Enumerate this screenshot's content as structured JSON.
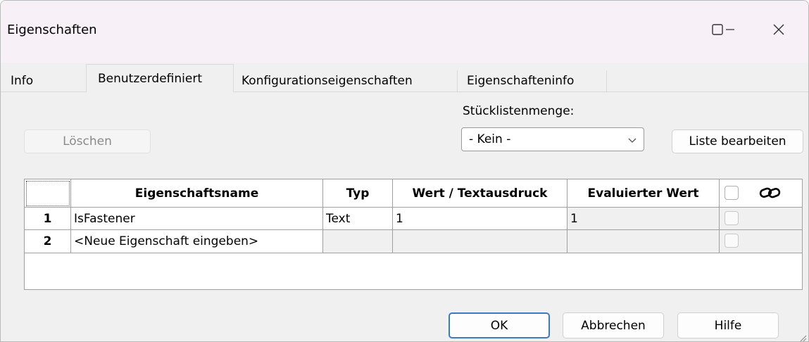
{
  "window": {
    "title": "Eigenschaften",
    "minimize_icon": "minimize-icon",
    "maximize_icon": "maximize-icon",
    "close_icon": "close-icon"
  },
  "tabs": [
    {
      "label": "Info",
      "active": false
    },
    {
      "label": "Benutzerdefiniert",
      "active": true
    },
    {
      "label": "Konfigurationseigenschaften",
      "active": false
    },
    {
      "label": "Eigenschafteninfo",
      "active": false
    }
  ],
  "toolbar": {
    "delete_label": "Löschen",
    "bom_qty_label": "Stücklistenmenge:",
    "bom_qty_value": "- Kein -",
    "edit_list_label": "Liste bearbeiten"
  },
  "table": {
    "columns": [
      "Eigenschaftsname",
      "Typ",
      "Wert / Textausdruck",
      "Evaluierter Wert"
    ],
    "link_icon": "link-icon",
    "rows": [
      {
        "num": "1",
        "name": "IsFastener",
        "type": "Text",
        "value": "1",
        "evaluated": "1"
      },
      {
        "num": "2",
        "name": "<Neue Eigenschaft eingeben>",
        "type": "",
        "value": "",
        "evaluated": ""
      }
    ]
  },
  "footer": {
    "ok_label": "OK",
    "cancel_label": "Abbrechen",
    "help_label": "Hilfe"
  },
  "colors": {
    "titlebar": "#f7f0f7",
    "window_bg": "#f0f0f0",
    "default_button_border": "#3f79c4"
  }
}
